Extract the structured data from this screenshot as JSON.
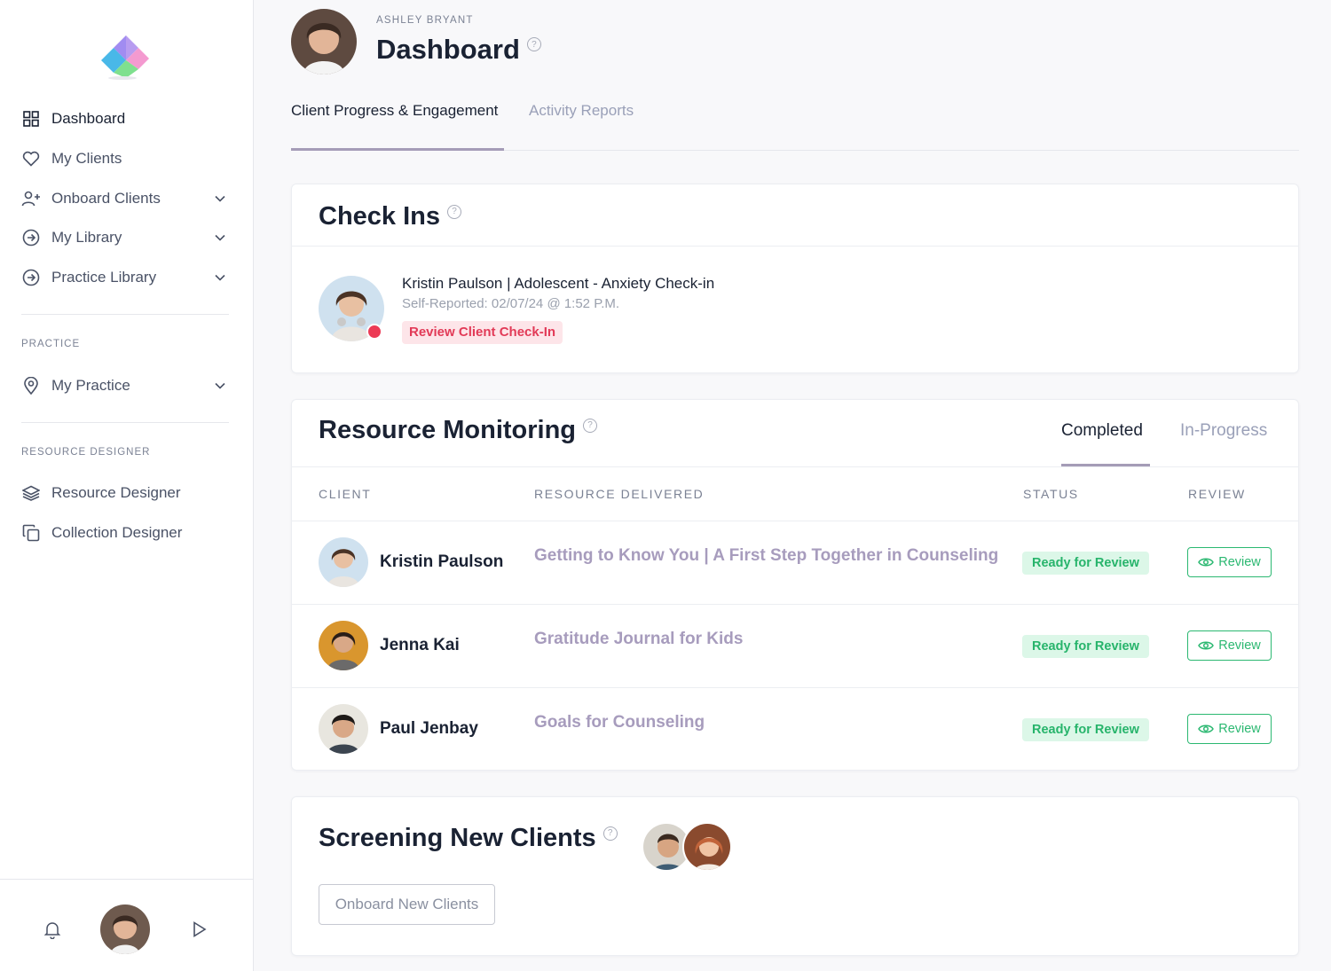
{
  "sidebar": {
    "nav": [
      {
        "label": "Dashboard",
        "icon": "grid-icon",
        "active": true
      },
      {
        "label": "My Clients",
        "icon": "heart-icon"
      },
      {
        "label": "Onboard Clients",
        "icon": "user-plus-icon",
        "expandable": true
      },
      {
        "label": "My Library",
        "icon": "arrow-circle-icon",
        "expandable": true
      },
      {
        "label": "Practice Library",
        "icon": "arrow-circle-icon",
        "expandable": true
      }
    ],
    "practice_label": "PRACTICE",
    "practice_nav": [
      {
        "label": "My Practice",
        "icon": "map-pin-icon",
        "expandable": true
      }
    ],
    "designer_label": "RESOURCE DESIGNER",
    "designer_nav": [
      {
        "label": "Resource Designer",
        "icon": "layers-icon"
      },
      {
        "label": "Collection Designer",
        "icon": "copy-icon"
      }
    ]
  },
  "header": {
    "user_name": "ASHLEY BRYANT",
    "title": "Dashboard",
    "help": "?"
  },
  "tabs": [
    {
      "label": "Client Progress & Engagement",
      "active": true
    },
    {
      "label": "Activity Reports",
      "active": false
    }
  ],
  "check_ins": {
    "title": "Check Ins",
    "help": "?",
    "item": {
      "name": "Kristin Paulson | Adolescent - Anxiety Check-in",
      "sub": "Self-Reported: 02/07/24 @ 1:52 P.M.",
      "badge": "Review Client Check-In"
    }
  },
  "resource_monitoring": {
    "title": "Resource Monitoring",
    "help": "?",
    "tabs": [
      {
        "label": "Completed",
        "active": true
      },
      {
        "label": "In-Progress",
        "active": false
      }
    ],
    "columns": [
      "CLIENT",
      "RESOURCE DELIVERED",
      "STATUS",
      "REVIEW"
    ],
    "rows": [
      {
        "client": "Kristin Paulson",
        "resource": "Getting to Know You | A First Step Together in Counseling",
        "status": "Ready for Review",
        "review": "Review"
      },
      {
        "client": "Jenna Kai",
        "resource": "Gratitude Journal for Kids",
        "status": "Ready for Review",
        "review": "Review"
      },
      {
        "client": "Paul Jenbay",
        "resource": "Goals for Counseling",
        "status": "Ready for Review",
        "review": "Review"
      }
    ]
  },
  "screening": {
    "title": "Screening New Clients",
    "help": "?",
    "button": "Onboard New Clients"
  },
  "colors": {
    "accent": "#a59cb7",
    "danger": "#e23a57",
    "success": "#2bb871"
  }
}
